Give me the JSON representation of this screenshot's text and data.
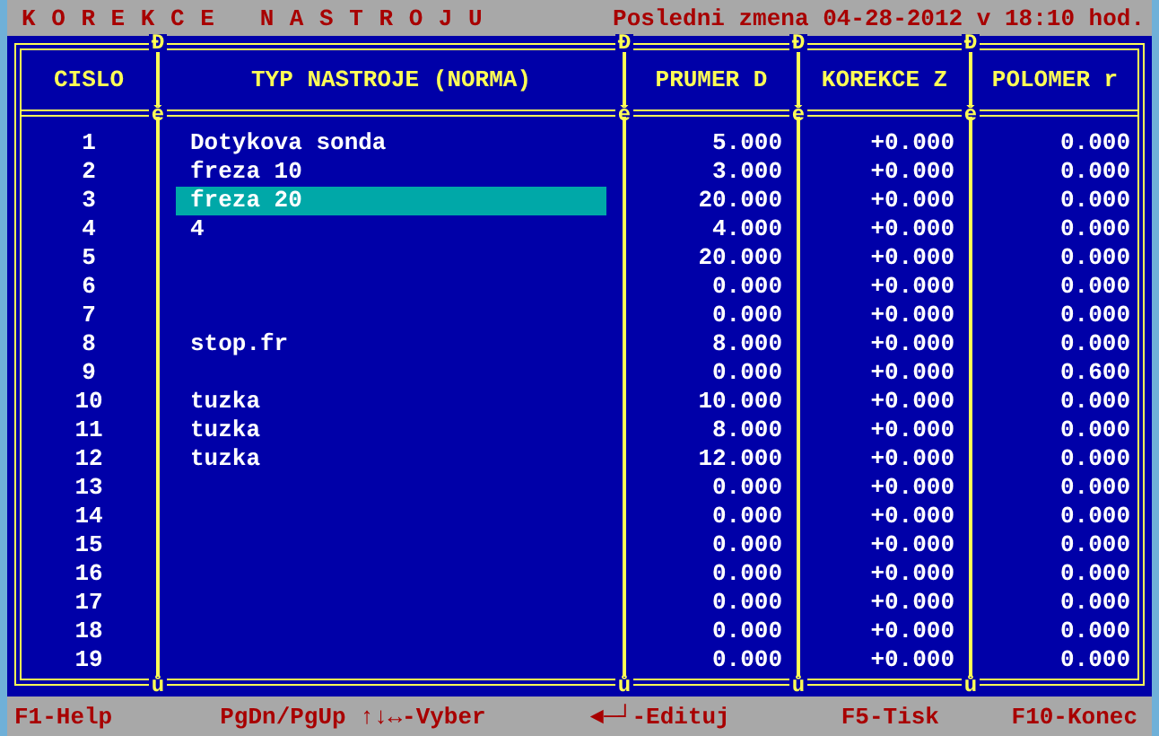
{
  "window": {
    "title": "K O R E K C E   N A S T R O J U",
    "last_change": "Posledni zmena 04-28-2012 v 18:10 hod."
  },
  "table": {
    "columns": [
      "CISLO",
      "TYP NASTROJE (NORMA)",
      "PRUMER D",
      "KOREKCE Z",
      "POLOMER r"
    ],
    "junctions_top": [
      "Đ",
      "Đ",
      "Đ",
      "Đ"
    ],
    "junctions_header": [
      "ě",
      "ě",
      "ě",
      "ě"
    ],
    "junctions_bottom": [
      "ů",
      "ů",
      "ů",
      "ů"
    ],
    "rows": [
      {
        "cislo": "1",
        "typ": "Dotykova sonda",
        "prumer": "5.000",
        "korekce": "+0.000",
        "polomer": "0.000",
        "selected": false
      },
      {
        "cislo": "2",
        "typ": "freza 10",
        "prumer": "3.000",
        "korekce": "+0.000",
        "polomer": "0.000",
        "selected": false
      },
      {
        "cislo": "3",
        "typ": "freza 20",
        "prumer": "20.000",
        "korekce": "+0.000",
        "polomer": "0.000",
        "selected": true
      },
      {
        "cislo": "4",
        "typ": "4",
        "prumer": "4.000",
        "korekce": "+0.000",
        "polomer": "0.000",
        "selected": false
      },
      {
        "cislo": "5",
        "typ": "",
        "prumer": "20.000",
        "korekce": "+0.000",
        "polomer": "0.000",
        "selected": false
      },
      {
        "cislo": "6",
        "typ": "",
        "prumer": "0.000",
        "korekce": "+0.000",
        "polomer": "0.000",
        "selected": false
      },
      {
        "cislo": "7",
        "typ": "",
        "prumer": "0.000",
        "korekce": "+0.000",
        "polomer": "0.000",
        "selected": false
      },
      {
        "cislo": "8",
        "typ": "stop.fr",
        "prumer": "8.000",
        "korekce": "+0.000",
        "polomer": "0.000",
        "selected": false
      },
      {
        "cislo": "9",
        "typ": "",
        "prumer": "0.000",
        "korekce": "+0.000",
        "polomer": "0.600",
        "selected": false
      },
      {
        "cislo": "10",
        "typ": "tuzka",
        "prumer": "10.000",
        "korekce": "+0.000",
        "polomer": "0.000",
        "selected": false
      },
      {
        "cislo": "11",
        "typ": "tuzka",
        "prumer": "8.000",
        "korekce": "+0.000",
        "polomer": "0.000",
        "selected": false
      },
      {
        "cislo": "12",
        "typ": "tuzka",
        "prumer": "12.000",
        "korekce": "+0.000",
        "polomer": "0.000",
        "selected": false
      },
      {
        "cislo": "13",
        "typ": "",
        "prumer": "0.000",
        "korekce": "+0.000",
        "polomer": "0.000",
        "selected": false
      },
      {
        "cislo": "14",
        "typ": "",
        "prumer": "0.000",
        "korekce": "+0.000",
        "polomer": "0.000",
        "selected": false
      },
      {
        "cislo": "15",
        "typ": "",
        "prumer": "0.000",
        "korekce": "+0.000",
        "polomer": "0.000",
        "selected": false
      },
      {
        "cislo": "16",
        "typ": "",
        "prumer": "0.000",
        "korekce": "+0.000",
        "polomer": "0.000",
        "selected": false
      },
      {
        "cislo": "17",
        "typ": "",
        "prumer": "0.000",
        "korekce": "+0.000",
        "polomer": "0.000",
        "selected": false
      },
      {
        "cislo": "18",
        "typ": "",
        "prumer": "0.000",
        "korekce": "+0.000",
        "polomer": "0.000",
        "selected": false
      },
      {
        "cislo": "19",
        "typ": "",
        "prumer": "0.000",
        "korekce": "+0.000",
        "polomer": "0.000",
        "selected": false
      }
    ]
  },
  "status_bar": [
    "F1-Help",
    "PgDn/PgUp ↑↓↔-Vyber",
    "◄─┘-Edituj",
    "F5-Tisk",
    "F10-Konec"
  ]
}
